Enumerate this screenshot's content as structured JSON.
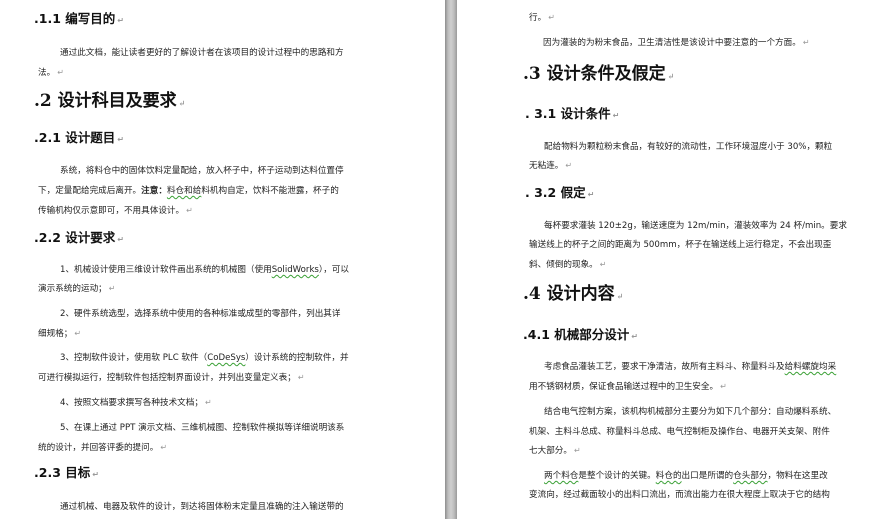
{
  "left": {
    "h_1_1": ".1.1 编写目的",
    "p_1_1": [
      "通过此文档，能让读者更好的了解设计者在该项目的设计过程中的思路和方",
      "法。"
    ],
    "h_2": ".2  设计科目及要求",
    "h_2_1": ".2.1 设计题目",
    "p_2_1": {
      "line1": "系统，将料仓中的固体饮料定量配给，放入杯子中，杯子运动到达料位置停",
      "line2_pre": "下，定量配给完成后离开。",
      "line2_bold": "注意：",
      "line2_wavy": "料仓和给",
      "line2_post": "料机构自定，饮料不能泄露，杯子的",
      "line3": "传输机构仅示意即可，不用具体设计。"
    },
    "h_2_2": ".2.2 设计要求",
    "req_1": {
      "line1_pre": "1、机械设计使用三维设计软件画出系统的机械图（使用",
      "line1_link": "SolidWorks",
      "line1_post": "），可以",
      "line2": "演示系统的运动；"
    },
    "req_2": [
      "2、硬件系统选型，选择系统中使用的各种标准或成型的零部件，列出其详",
      "细规格；"
    ],
    "req_3": {
      "line1_pre": "3、控制软件设计，使用软 PLC 软件（",
      "line1_link": "CoDeSys",
      "line1_post": "）设计系统的控制软件，并",
      "line2": "可进行模拟运行，控制软件包括控制界面设计，并列出变量定义表；"
    },
    "req_4": "4、按照文档要求撰写各种技术文档；",
    "req_5": [
      "5、在课上通过 PPT 演示文档、三维机械图、控制软件模拟等详细说明该系",
      "统的设计，并回答评委的提问。"
    ],
    "h_2_3": ".2.3 目标",
    "p_2_3": "通过机械、电器及软件的设计，到达将固体粉末定量且准确的注入输送带的"
  },
  "right": {
    "top_line": "行。",
    "p_hygiene": "因为灌装的为粉末食品，卫生清洁性是该设计中要注意的一个方面。",
    "h_3": ".3 设计条件及假定",
    "h_3_1": ". 3.1  设计条件",
    "p_3_1": [
      "配给物料为颗粒粉末食品，有较好的流动性，工作环境湿度小于 30%，颗粒",
      "无粘连。"
    ],
    "h_3_2": ". 3.2 假定",
    "p_3_2": [
      "每杯要求灌装 120±2g，输送速度为 12m/min，灌装效率为 24 杯/min。要求",
      "输送线上的杯子之间的距离为 500mm，杯子在输送线上运行稳定，不会出现歪",
      "斜、倾倒的现象。"
    ],
    "h_4": ".4  设计内容",
    "h_4_1": ".4.1 机械部分设计",
    "p_4_1a": {
      "line1_pre": "考虑食品灌装工艺，要求干净清洁，故所有主料斗、称量料斗及",
      "line1_wavy": "给料螺旋均采",
      "line2": "用不锈钢材质，保证食品输送过程中的卫生安全。"
    },
    "p_4_1b": [
      "结合电气控制方案，该机构机械部分主要分为如下几个部分：自动爆料系统、",
      "机架、主料斗总成、称量料斗总成、电气控制柜及操作台、电器开关支架、附件",
      "七大部分。"
    ],
    "p_4_1c": {
      "line1_wavy1": "两个料仓",
      "line1_mid": "是整个设计的关键。",
      "line1_wavy2": "料仓的",
      "line1_mid2": "出口是所谓的",
      "line1_wavy3": "仓头部分",
      "line1_post": "，物料在这里改",
      "line2": "变流向，经过截面较小的出料口流出，而流出能力在很大程度上取决于它的结构"
    }
  }
}
